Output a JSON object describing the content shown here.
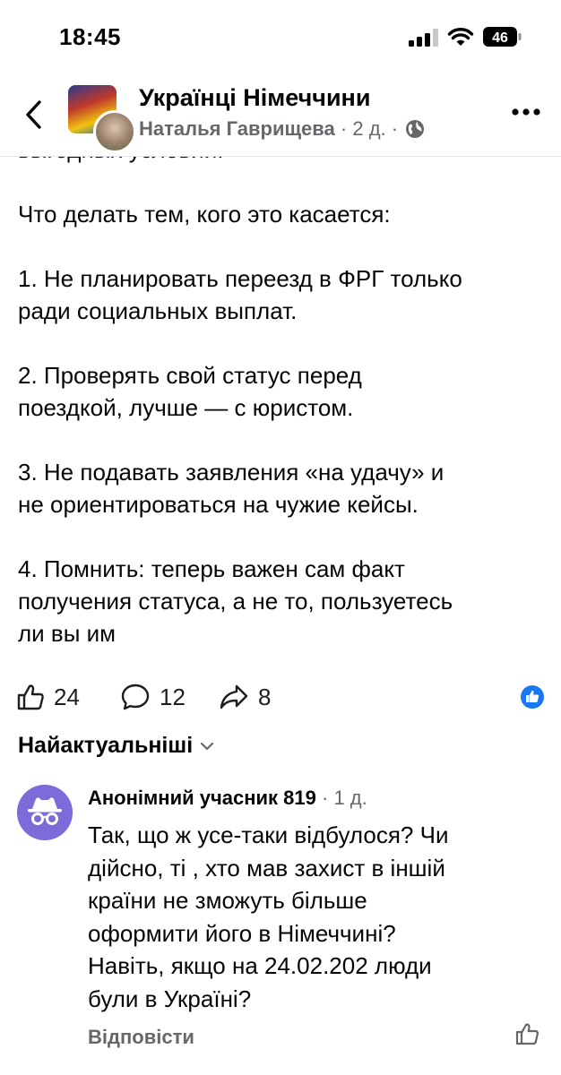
{
  "status_bar": {
    "time": "18:45",
    "battery_level": "46",
    "icons": [
      "signal-icon",
      "wifi-icon",
      "battery-icon"
    ]
  },
  "header": {
    "group_name": "Українці Німеччини",
    "author": "Наталья Гаврищева",
    "age": "2 д.",
    "separator": "·",
    "audience_icon": "globe-icon"
  },
  "post": {
    "lines": [
      "выгодных условий.",
      "",
      "Что делать тем, кого это касается:",
      "",
      "1. Не планировать переезд в ФРГ только",
      "ради социальных выплат.",
      "",
      "2. Проверять свой статус перед",
      "поездкой, лучше — с юристом.",
      "",
      "3. Не подавать заявления «на удачу» и",
      "не ориентироваться на чужие кейсы.",
      "",
      "4. Помнить: теперь важен сам факт",
      "получения статуса, а не то, пользуетесь",
      "ли вы им"
    ]
  },
  "actions": {
    "likes": "24",
    "comments": "12",
    "shares": "8"
  },
  "sort": {
    "label": "Найактуальніші"
  },
  "comment": {
    "author": "Анонімний учасник 819",
    "separator": "·",
    "time": "1 д.",
    "lines": [
      "Так, що ж усе-таки відбулося? Чи",
      "дійсно, ті , хто мав захист в іншій",
      "країни не зможуть більше",
      "оформити його в Німеччині?",
      "Навіть, якщо на 24.02.202 люди",
      "були в Україні?"
    ],
    "reply_label": "Відповісти"
  },
  "colors": {
    "accent": "#1877f2",
    "secondary_text": "#65676b",
    "anon_avatar": "#7b6cd9"
  }
}
